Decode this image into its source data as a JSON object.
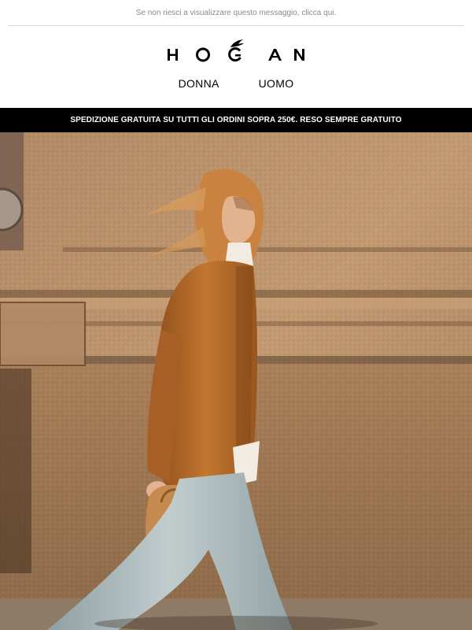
{
  "preheader": {
    "text": "Se non riesci a visualizzare questo messaggio, clicca qui."
  },
  "brand": {
    "logo_text": "HOGAN"
  },
  "nav": {
    "items": [
      {
        "label": "DONNA"
      },
      {
        "label": "UOMO"
      }
    ]
  },
  "banner": {
    "text": "SPEDIZIONE GRATUITA SU TUTTI GLI ORDINI SOPRA 250€. RESO SEMPRE GRATUITO"
  },
  "hero": {
    "alt_subject": "woman-walking-leather-jacket-photo"
  },
  "colors": {
    "banner_bg": "#000000",
    "banner_text": "#ffffff",
    "wall": "#b88c63",
    "jacket": "#b86a2c",
    "jeans": "#a9b6b8"
  }
}
